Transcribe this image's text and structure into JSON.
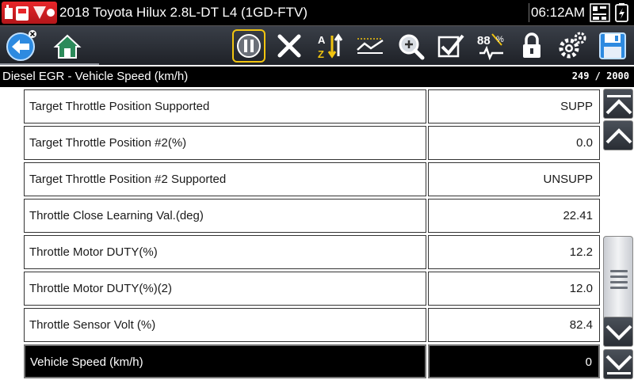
{
  "titlebar": {
    "title": "2018 Toyota Hilux 2.8L-DT L4 (1GD-FTV)",
    "time": "06:12AM"
  },
  "toolbar": {
    "buttons": [
      {
        "name": "back",
        "icon": "back-arrow-icon"
      },
      {
        "name": "home",
        "icon": "home-icon"
      },
      {
        "name": "pause",
        "icon": "pause-icon"
      },
      {
        "name": "clear",
        "icon": "close-x-icon"
      },
      {
        "name": "sort",
        "icon": "sort-az-icon"
      },
      {
        "name": "graph",
        "icon": "graph-view-icon"
      },
      {
        "name": "zoom",
        "icon": "zoom-icon"
      },
      {
        "name": "select",
        "icon": "checkmark-icon"
      },
      {
        "name": "units",
        "icon": "units-88-icon"
      },
      {
        "name": "lock",
        "icon": "lock-icon"
      },
      {
        "name": "settings",
        "icon": "gear-icon"
      },
      {
        "name": "save",
        "icon": "save-disk-icon"
      }
    ]
  },
  "header": {
    "title": "Diesel EGR - Vehicle Speed (km/h)",
    "count": "249 / 2000"
  },
  "rows": [
    {
      "name": "Target Throttle Position Supported",
      "value": "SUPP"
    },
    {
      "name": "Target Throttle Position #2(%)",
      "value": "0.0"
    },
    {
      "name": "Target Throttle Position #2 Supported",
      "value": "UNSUPP"
    },
    {
      "name": "Throttle Close Learning Val.(deg)",
      "value": "22.41"
    },
    {
      "name": "Throttle Motor DUTY(%)",
      "value": "12.2"
    },
    {
      "name": "Throttle Motor DUTY(%)(2)",
      "value": "12.0"
    },
    {
      "name": "Throttle Sensor Volt (%)",
      "value": "82.4"
    },
    {
      "name": "Vehicle Speed (km/h)",
      "value": "0",
      "selected": true
    }
  ],
  "colors": {
    "accent_yellow": "#f1c40f",
    "toolbar_dark": "#1e2127",
    "title_red": "#e8262a"
  }
}
